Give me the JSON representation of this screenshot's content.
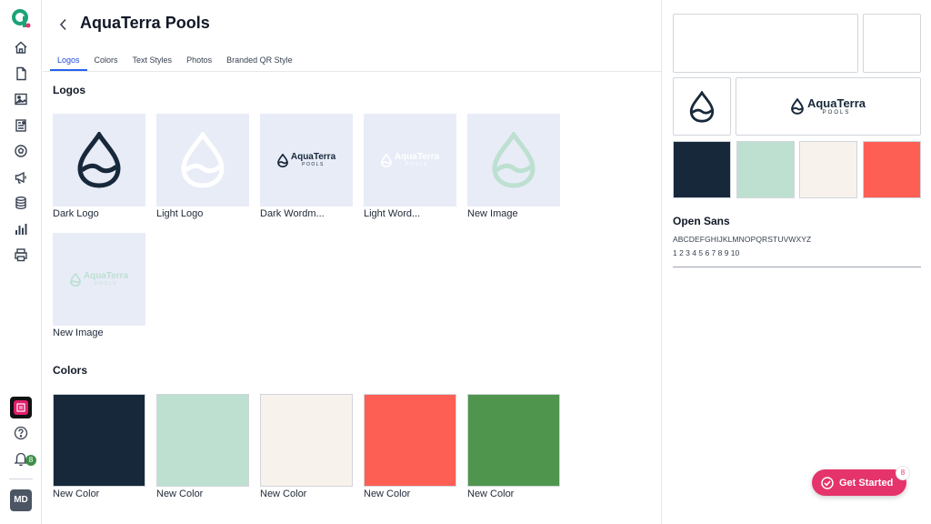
{
  "page": {
    "title": "AquaTerra Pools"
  },
  "tabs": [
    {
      "label": "Logos",
      "active": true
    },
    {
      "label": "Colors",
      "active": false
    },
    {
      "label": "Text Styles",
      "active": false
    },
    {
      "label": "Photos",
      "active": false
    },
    {
      "label": "Branded QR Style",
      "active": false
    }
  ],
  "logos": {
    "heading": "Logos",
    "items": [
      {
        "label": "Dark Logo",
        "icon": "water-drop-dark"
      },
      {
        "label": "Light Logo",
        "icon": "water-drop-light"
      },
      {
        "label": "Dark Wordm...",
        "icon": "wordmark-dark"
      },
      {
        "label": "Light Word...",
        "icon": "wordmark-light"
      },
      {
        "label": "New Image",
        "icon": "water-drop-mint"
      },
      {
        "label": "New Image",
        "icon": "wordmark-mint"
      }
    ]
  },
  "wordmark": {
    "line1": "AquaTerra",
    "line2": "POOLS"
  },
  "colors": {
    "heading": "Colors",
    "items": [
      {
        "label": "New Color",
        "hex": "#17283b"
      },
      {
        "label": "New Color",
        "hex": "#bde0d1"
      },
      {
        "label": "New Color",
        "hex": "#f7f3ec"
      },
      {
        "label": "New Color",
        "hex": "#fe5f55"
      },
      {
        "label": "New Color",
        "hex": "#4f954e"
      }
    ]
  },
  "preview": {
    "swatches": [
      "#17283b",
      "#bde0d1",
      "#f7f3ec",
      "#fe5f55"
    ],
    "font_name": "Open Sans",
    "font_alphabet": "ABCDEFGHIJKLMNOPQRSTUVWXYZ",
    "font_numbers": "1 2 3 4 5 6 7 8 9 10"
  },
  "rail": {
    "nav_icons": [
      "home-icon",
      "document-icon",
      "image-icon",
      "report-icon",
      "soccer-ball-icon",
      "megaphone-icon",
      "database-icon",
      "bar-chart-icon",
      "printer-icon"
    ],
    "notifications_count": "8",
    "avatar_initials": "MD"
  },
  "get_started": {
    "label": "Get Started",
    "badge": "8"
  },
  "brand_colors": {
    "accent": "#2563eb",
    "cta": "#e5336b"
  }
}
